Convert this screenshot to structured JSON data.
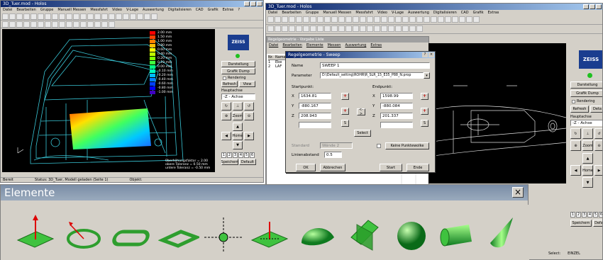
{
  "win1": {
    "title": "3D_Tuer.mod - Holos",
    "menu": [
      "Datei",
      "Bearbeiten",
      "Gruppe",
      "Manuell Messen",
      "Messfahrt",
      "Video",
      "V-Lage",
      "Auswertung",
      "Digitalisieren",
      "CAD",
      "Grafik",
      "Extras",
      "?"
    ],
    "legend": [
      "2.00 mm",
      "1.50 mm",
      "1.00 mm",
      "0.80 mm",
      "0.60 mm",
      "0.40 mm",
      "0.20 mm",
      "0.10 mm",
      "0.00 mm",
      "-0.10 mm",
      "-0.20 mm",
      "-0.40 mm",
      "-0.60 mm",
      "-0.80 mm",
      "-1.00 mm"
    ],
    "legend_colors": [
      "#ff0000",
      "#ff4000",
      "#ff8000",
      "#ffbf00",
      "#ffff00",
      "#bfff00",
      "#80ff00",
      "#40ff40",
      "#00ff80",
      "#00ffbf",
      "#00bfff",
      "#0080ff",
      "#0040ff",
      "#0000ff",
      "#4000c0"
    ],
    "info": [
      "Überhöhungsfaktor = 2.00",
      "obere Toleranz = 0.50 mm",
      "untere Toleranz = -0.50 mm"
    ],
    "status": [
      "Bereit",
      "Status: 3D_Tuer, Modell geladen (Seite 1)",
      "Objekt:"
    ],
    "side": {
      "darstellung": "Darstellung",
      "grafik_dump": "Grafik Dump",
      "rendering": "Rendering",
      "refresh": "Refresh",
      "view": "View",
      "hauptachse": "Hauptachse",
      "achse": "-Z - Achse",
      "zoom": "Zoom",
      "home": "Home",
      "speichern": "Speichern",
      "default": "Default",
      "pages": [
        "1",
        "2",
        "3",
        "4",
        "5",
        "6"
      ]
    }
  },
  "win2": {
    "title": "3D_Tuer.mod - Holos",
    "menu": [
      "Datei",
      "Bearbeiten",
      "Gruppe",
      "Manuell Messen",
      "Messfahrt",
      "Video",
      "V-Lage",
      "Auswertung",
      "Digitalisieren",
      "CAD",
      "Grafik",
      "Extras"
    ],
    "sub_title": "Regelgeometrie - Vorgabe Liste",
    "sub_menu": [
      "Datei",
      "Bearbeiten",
      "Elemente",
      "Messen",
      "Auswertung",
      "Extras"
    ],
    "table_head": [
      "Nr.",
      "Name"
    ],
    "table_rows": [
      [
        "1",
        "Ebe"
      ],
      [
        "2",
        "LAF"
      ]
    ],
    "status": [
      "Select:",
      "EINZEL"
    ],
    "side": {
      "darstellung": "Darstellung",
      "grafik_dump": "Grafik Dump",
      "rendering": "Rendering",
      "refresh": "Refresh",
      "deta": "Deta",
      "hauptachse": "Hauptachse",
      "achse": "-Z - Achse",
      "zoom": "Zoom",
      "home": "Home",
      "speichern": "Speichern",
      "default": "Defa",
      "pages": [
        "1",
        "2",
        "3",
        "4",
        "5",
        "6"
      ]
    }
  },
  "dialog": {
    "title": "Regelgeometrie - Sweep",
    "name_label": "Name",
    "name_value": "SWEEP 1",
    "param_label": "Parameter",
    "param_value": "D:\\Default_setting\\ROHR\\R_SLR_15_E35_P88_N.prop",
    "start_label": "Startpunkt:",
    "end_label": "Endpunkt:",
    "start": {
      "x": "1634.81",
      "y": "-880.167",
      "z": "208.943"
    },
    "end": {
      "x": "1598.99",
      "y": "-880.084",
      "z": "201.337"
    },
    "axes": [
      "X",
      "Y",
      "Z"
    ],
    "select": "Select",
    "standard_label": "Standard",
    "standard_value": "Wände 2",
    "linien_label": "Linienabstand",
    "linien_value": "0.5",
    "kein_label": "Keine Punktewolke",
    "buttons": [
      "OK",
      "Abbrechen",
      "Start",
      "Ende"
    ],
    "s_label": "S",
    "swap": "<->"
  },
  "elemente": {
    "title": "Elemente",
    "close": "×",
    "icons": [
      "plane-icon",
      "circle-icon",
      "slot-icon",
      "rectangle-icon",
      "point-icon",
      "plane-point-icon",
      "sphere-cap-icon",
      "intersect-plane-icon",
      "sphere-icon",
      "cylinder-icon",
      "cone-icon"
    ]
  },
  "zeiss": "ZEISS"
}
